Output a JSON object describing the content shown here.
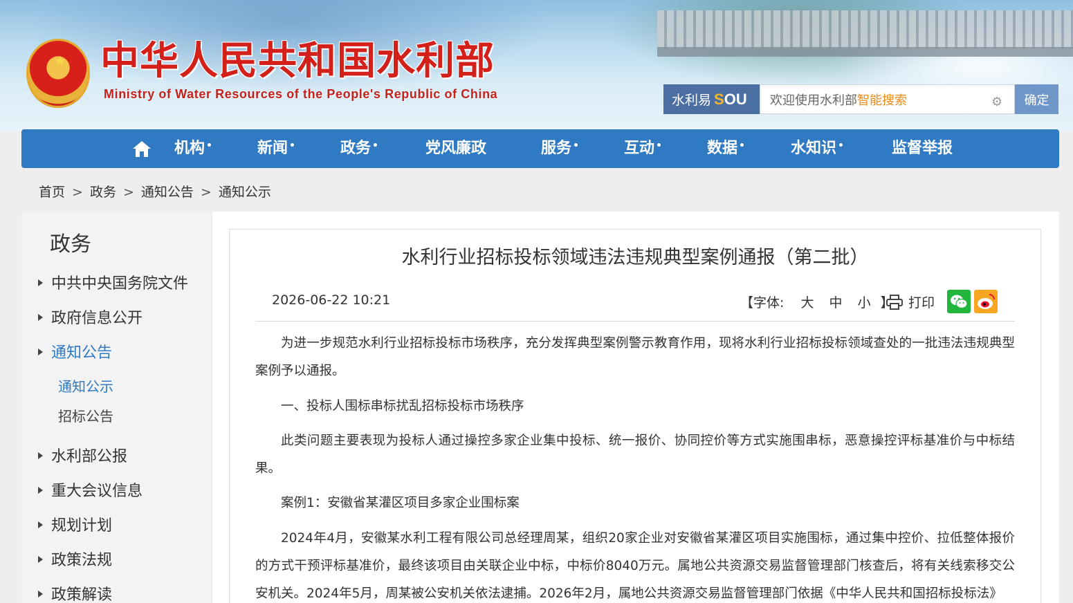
{
  "header": {
    "title": "中华人民共和国水利部",
    "subtitle": "Ministry of Water Resources of the People's Republic of China"
  },
  "search": {
    "brand_prefix": "水利易",
    "brand_sou_first": "S",
    "brand_sou_rest": "OU",
    "placeholder_prefix": "欢迎使用水利部",
    "placeholder_highlight": "智能搜索",
    "button": "确定"
  },
  "nav": {
    "items": [
      {
        "label": "机构",
        "dropdown": "•"
      },
      {
        "label": "新闻",
        "dropdown": "•"
      },
      {
        "label": "政务",
        "dropdown": "•"
      },
      {
        "label": "党风廉政",
        "dropdown": ""
      },
      {
        "label": "服务",
        "dropdown": "•"
      },
      {
        "label": "互动",
        "dropdown": "•"
      },
      {
        "label": "数据",
        "dropdown": "•"
      },
      {
        "label": "水知识",
        "dropdown": "•"
      },
      {
        "label": "监督举报",
        "dropdown": ""
      }
    ]
  },
  "breadcrumb": {
    "items": [
      "首页",
      "政务",
      "通知公告",
      "通知公示"
    ],
    "separator": ">"
  },
  "sidebar": {
    "title": "政务",
    "items": [
      {
        "label": "中共中央国务院文件"
      },
      {
        "label": "政府信息公开"
      },
      {
        "label": "通知公告"
      },
      {
        "label": "水利部公报"
      },
      {
        "label": "重大会议信息"
      },
      {
        "label": "规划计划"
      },
      {
        "label": "政策法规"
      },
      {
        "label": "政策解读"
      }
    ],
    "subitems": [
      {
        "label": "通知公示"
      },
      {
        "label": "招标公告"
      }
    ]
  },
  "article": {
    "title": "水利行业招标投标领域违法违规典型案例通报（第二批）",
    "date": "2026-06-22 10:21",
    "font_label": "【字体:",
    "font_large": "大",
    "font_medium": "中",
    "font_small": "小",
    "font_close": "】",
    "print_label": "打印",
    "paragraphs": [
      "为进一步规范水利行业招标投标市场秩序，充分发挥典型案例警示教育作用，现将水利行业招标投标领域查处的一批违法违规典型案例予以通报。",
      "一、投标人围标串标扰乱招标投标市场秩序",
      "此类问题主要表现为投标人通过操控多家企业集中投标、统一报价、协同控价等方式实施围串标，恶意操控评标基准价与中标结果。",
      "案例1：安徽省某灌区项目多家企业围标案",
      "2024年4月，安徽某水利工程有限公司总经理周某，组织20家企业对安徽省某灌区项目实施围标，通过集中控价、拉低整体报价的方式干预评标基准价，最终该项目由关联企业中标，中标价8040万元。属地公共资源交易监督管理部门核查后，将有关线索移交公安机关。2024年5月，周某被公安机关依法逮捕。2026年2月，属地公共资源交易监督管理部门依据《中华人民共和国招标投标法》"
    ]
  },
  "colors": {
    "brand_red": "#d4201a",
    "nav_blue": "#2f7ac2",
    "active_blue": "#2f7ac2",
    "search_highlight": "#f08a16"
  }
}
